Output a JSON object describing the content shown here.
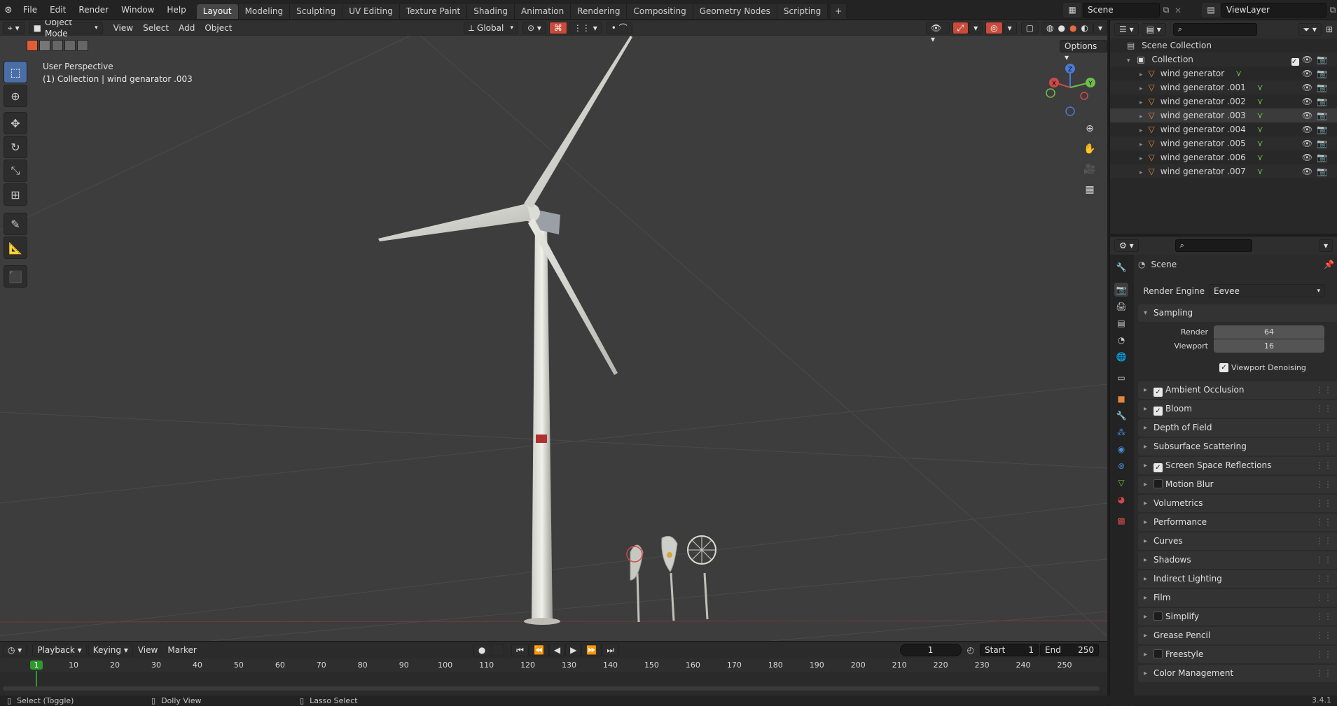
{
  "topbar": {
    "menus": [
      "File",
      "Edit",
      "Render",
      "Window",
      "Help"
    ],
    "workspaces": [
      "Layout",
      "Modeling",
      "Sculpting",
      "UV Editing",
      "Texture Paint",
      "Shading",
      "Animation",
      "Rendering",
      "Compositing",
      "Geometry Nodes",
      "Scripting"
    ],
    "active_workspace": "Layout",
    "add_tab": "+",
    "scene": "Scene",
    "view_layer": "ViewLayer"
  },
  "viewport": {
    "mode": "Object Mode",
    "menus": [
      "View",
      "Select",
      "Add",
      "Object"
    ],
    "transform_orientation": "Global",
    "options": "Options",
    "overlay_line1": "User Perspective",
    "overlay_line2": "(1) Collection | wind genarator .003",
    "gizmo": {
      "x": "X",
      "y": "Y",
      "z": "Z"
    }
  },
  "outliner": {
    "root": "Scene Collection",
    "collection": "Collection",
    "items": [
      {
        "name": "wind generator",
        "selected": false
      },
      {
        "name": "wind generator .001",
        "selected": false
      },
      {
        "name": "wind generator .002",
        "selected": false
      },
      {
        "name": "wind generator .003",
        "selected": true
      },
      {
        "name": "wind generator .004",
        "selected": false
      },
      {
        "name": "wind generator .005",
        "selected": false
      },
      {
        "name": "wind generator .006",
        "selected": false
      },
      {
        "name": "wind generator .007",
        "selected": false
      }
    ]
  },
  "properties": {
    "context": "Scene",
    "render_engine_label": "Render Engine",
    "render_engine": "Eevee",
    "sampling": {
      "title": "Sampling",
      "render_label": "Render",
      "render_value": "64",
      "viewport_label": "Viewport",
      "viewport_value": "16",
      "denoise_label": "Viewport Denoising"
    },
    "panels": [
      {
        "label": "Ambient Occlusion",
        "checkbox": "on"
      },
      {
        "label": "Bloom",
        "checkbox": "on"
      },
      {
        "label": "Depth of Field",
        "checkbox": "none"
      },
      {
        "label": "Subsurface Scattering",
        "checkbox": "none"
      },
      {
        "label": "Screen Space Reflections",
        "checkbox": "on"
      },
      {
        "label": "Motion Blur",
        "checkbox": "off"
      },
      {
        "label": "Volumetrics",
        "checkbox": "none"
      },
      {
        "label": "Performance",
        "checkbox": "none"
      },
      {
        "label": "Curves",
        "checkbox": "none"
      },
      {
        "label": "Shadows",
        "checkbox": "none"
      },
      {
        "label": "Indirect Lighting",
        "checkbox": "none"
      },
      {
        "label": "Film",
        "checkbox": "none"
      },
      {
        "label": "Simplify",
        "checkbox": "off"
      },
      {
        "label": "Grease Pencil",
        "checkbox": "none"
      },
      {
        "label": "Freestyle",
        "checkbox": "off"
      },
      {
        "label": "Color Management",
        "checkbox": "none"
      }
    ]
  },
  "timeline": {
    "menus": [
      "Playback",
      "Keying",
      "View",
      "Marker"
    ],
    "current_frame": "1",
    "start_label": "Start",
    "start": "1",
    "end_label": "End",
    "end": "250",
    "ruler": [
      "1",
      "10",
      "20",
      "30",
      "40",
      "50",
      "60",
      "70",
      "80",
      "90",
      "100",
      "110",
      "120",
      "130",
      "140",
      "150",
      "160",
      "170",
      "180",
      "190",
      "200",
      "210",
      "220",
      "230",
      "240",
      "250"
    ]
  },
  "statusbar": {
    "left": "Select (Toggle)",
    "middle": "Dolly View",
    "right": "Lasso Select",
    "version": "3.4.1"
  },
  "colors": {
    "accent": "#4a6ea6",
    "object_orange": "#e0883a",
    "mesh_green": "#6fbf4a",
    "frame_green": "#2e9a2e"
  }
}
